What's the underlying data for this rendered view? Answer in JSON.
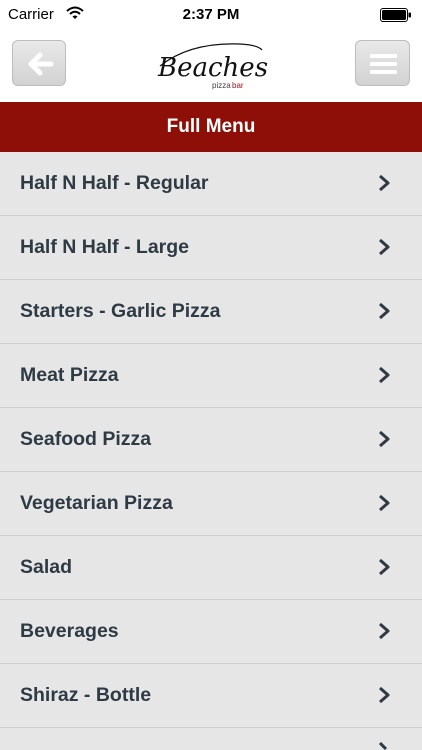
{
  "status_bar": {
    "carrier": "Carrier",
    "time": "2:37 PM"
  },
  "header": {
    "back_icon": "back-arrow-icon",
    "menu_icon": "hamburger-menu-icon",
    "logo": {
      "brand": "Beaches",
      "sub_left": "pizza",
      "sub_right": "bar"
    }
  },
  "title": "Full Menu",
  "menu_items": [
    {
      "label": "Half N Half - Regular"
    },
    {
      "label": "Half N Half - Large"
    },
    {
      "label": "Starters - Garlic Pizza"
    },
    {
      "label": "Meat Pizza"
    },
    {
      "label": "Seafood Pizza"
    },
    {
      "label": "Vegetarian Pizza"
    },
    {
      "label": "Salad"
    },
    {
      "label": "Beverages"
    },
    {
      "label": "Shiraz - Bottle"
    }
  ],
  "colors": {
    "title_bar": "#8e0f07",
    "list_bg": "#e6e6e6",
    "item_text": "#2f3b44"
  }
}
